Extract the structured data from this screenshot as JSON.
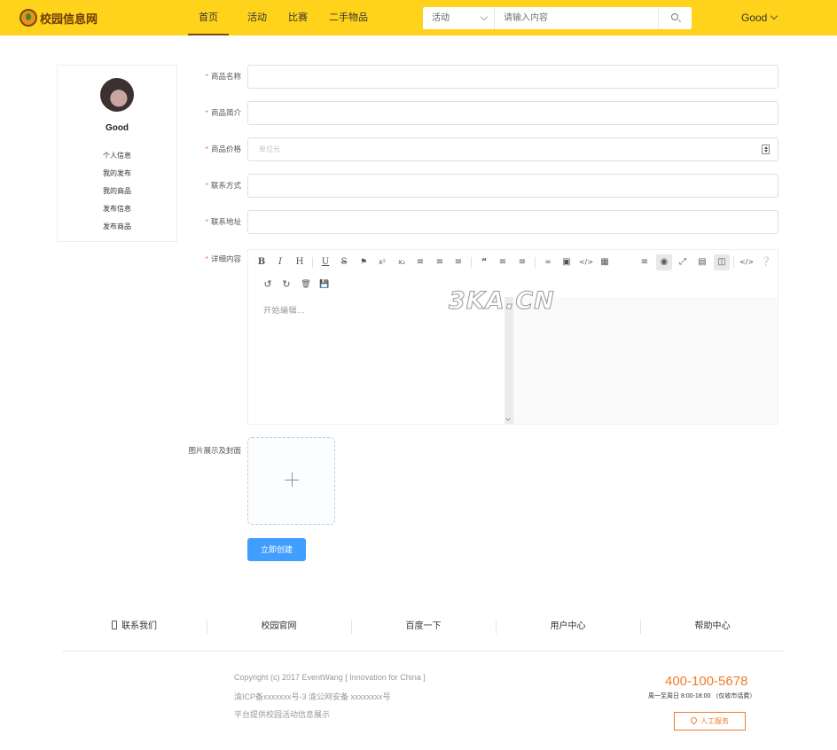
{
  "header": {
    "logo_text": "校园信息网",
    "nav": [
      "首页",
      "活动",
      "比赛",
      "二手物品"
    ],
    "search": {
      "category": "活动",
      "placeholder": "请输入内容"
    },
    "user": "Good"
  },
  "sidebar": {
    "name": "Good",
    "menu": [
      "个人信息",
      "我的发布",
      "我的商品",
      "发布信息",
      "发布商品"
    ]
  },
  "form": {
    "required_mark": "*",
    "fields": [
      {
        "label": "商品名称",
        "placeholder": ""
      },
      {
        "label": "商品简介",
        "placeholder": ""
      },
      {
        "label": "商品价格",
        "placeholder": "单位元"
      },
      {
        "label": "联系方式",
        "placeholder": ""
      },
      {
        "label": "联系地址",
        "placeholder": ""
      }
    ],
    "detail_label": "详细内容",
    "editor_placeholder": "开始编辑...",
    "upload_label": "图片展示及封面",
    "submit": "立即创建"
  },
  "toolbar": {
    "icons": [
      "bold-icon",
      "italic-icon",
      "heading-icon",
      "underline-icon",
      "strikethrough-icon",
      "mark-icon",
      "superscript-icon",
      "subscript-icon",
      "align-left-icon",
      "align-center-icon",
      "align-right-icon",
      "quote-icon",
      "ordered-list-icon",
      "unordered-list-icon",
      "link-icon",
      "image-icon",
      "code-icon",
      "table-icon",
      "navigation-icon",
      "preview-icon",
      "fullscreen-icon",
      "read-mode-icon",
      "split-view-icon",
      "html-icon",
      "help-icon",
      "undo-icon",
      "redo-icon",
      "trash-icon",
      "save-icon"
    ]
  },
  "watermark": "3KA.CN",
  "footer": {
    "links": [
      "联系我们",
      "校园官网",
      "百度一下",
      "用户中心",
      "帮助中心"
    ],
    "copyright": [
      "Copyright (c) 2017 EventWang [ Innovation for China ]",
      "渝ICP备xxxxxxx号-3 渝公网安备 xxxxxxxx号",
      "平台提供校园活动信息展示"
    ],
    "hotline": "400-100-5678",
    "hours": "周一至周日 8:00-18:00 （仅收市话费）",
    "service": "人工服务"
  },
  "colors": {
    "header_bg": "#ffd31c",
    "primary": "#409eff",
    "accent": "#ef7d2d",
    "required": "#f56c6c"
  }
}
